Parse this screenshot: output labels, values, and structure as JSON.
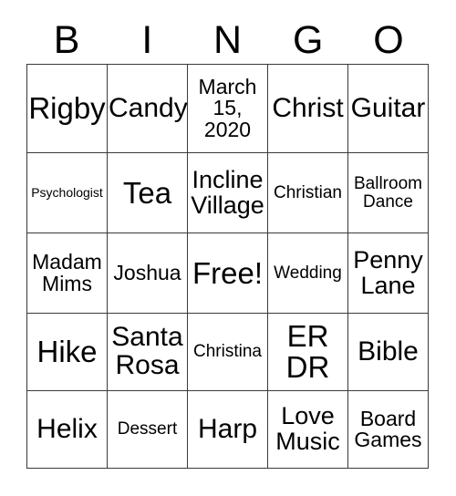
{
  "card": {
    "type": "bingo-card",
    "header_letters": [
      "B",
      "I",
      "N",
      "G",
      "O"
    ],
    "columns": 5,
    "rows": 5,
    "free_space": "Free!",
    "free_space_position": "center",
    "colors": {
      "background": "#ffffff",
      "text": "#000000",
      "grid_line": "#3a3a3a"
    },
    "cells": [
      [
        {
          "text": "Rigby",
          "size": "xxl"
        },
        {
          "text": "Candy",
          "size": "xl"
        },
        {
          "text": "March 15, 2020",
          "size": "md"
        },
        {
          "text": "Christ",
          "size": "xl"
        },
        {
          "text": "Guitar",
          "size": "xl"
        }
      ],
      [
        {
          "text": "Psychologist",
          "size": "xs"
        },
        {
          "text": "Tea",
          "size": "xxl"
        },
        {
          "text": "Incline Village",
          "size": "lg"
        },
        {
          "text": "Christian",
          "size": "sm"
        },
        {
          "text": "Ballroom Dance",
          "size": "sm"
        }
      ],
      [
        {
          "text": "Madam Mims",
          "size": "md"
        },
        {
          "text": "Joshua",
          "size": "md"
        },
        {
          "text": "Free!",
          "size": "xxl"
        },
        {
          "text": "Wedding",
          "size": "sm"
        },
        {
          "text": "Penny Lane",
          "size": "lg"
        }
      ],
      [
        {
          "text": "Hike",
          "size": "xxl"
        },
        {
          "text": "Santa Rosa",
          "size": "xl"
        },
        {
          "text": "Christina",
          "size": "sm"
        },
        {
          "text": "ER DR",
          "size": "xxl"
        },
        {
          "text": "Bible",
          "size": "xl"
        }
      ],
      [
        {
          "text": "Helix",
          "size": "xl"
        },
        {
          "text": "Dessert",
          "size": "sm"
        },
        {
          "text": "Harp",
          "size": "xl"
        },
        {
          "text": "Love Music",
          "size": "lg"
        },
        {
          "text": "Board Games",
          "size": "md"
        }
      ]
    ]
  }
}
